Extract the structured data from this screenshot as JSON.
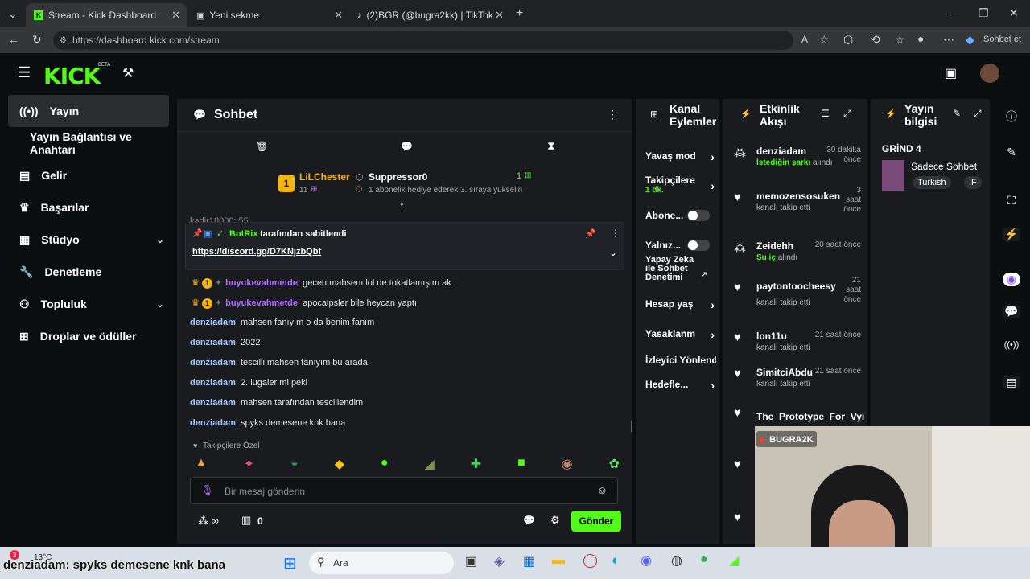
{
  "browser": {
    "tabs": [
      {
        "label": "Stream - Kick Dashboard",
        "active": true
      },
      {
        "label": "Yeni sekme",
        "active": false
      },
      {
        "label": "(2)BGR (@bugra2kk) | TikTok",
        "active": false
      }
    ],
    "url": "https://dashboard.kick.com/stream",
    "copilot_label": "Sohbet et"
  },
  "app": {
    "logo": "KICK",
    "beta": "BETA"
  },
  "sidebar": {
    "items": [
      {
        "label": "Yayın",
        "icon": "broadcast-icon"
      },
      {
        "label": "Yayın Bağlantısı ve Anahtarı",
        "icon": ""
      },
      {
        "label": "Gelir",
        "icon": "wallet-icon"
      },
      {
        "label": "Başarılar",
        "icon": "trophy-icon"
      },
      {
        "label": "Stüdyo",
        "icon": "studio-icon"
      },
      {
        "label": "Denetleme",
        "icon": "wrench-icon"
      },
      {
        "label": "Topluluk",
        "icon": "community-icon"
      },
      {
        "label": "Droplar ve ödüller",
        "icon": "gift-icon"
      }
    ]
  },
  "chat": {
    "title": "Sohbet",
    "leader": {
      "name": "LiLChester",
      "count": "11",
      "rank": "1"
    },
    "second": {
      "name": "Suppressor0",
      "subtext": "1 abonelik hediye ederek 3. sıraya yükselin",
      "count": "1"
    },
    "partial_line": "kadir18000: 55",
    "pinned": {
      "by": "BotRix",
      "suffix": "tarafından sabitlendi",
      "link": "https://discord.gg/D7KNjzbQbf"
    },
    "messages": [
      {
        "user": "buyukevahmetde",
        "text": ": gecen mahsenı lol de tokatlamışım ak",
        "purple": true
      },
      {
        "user": "buyukevahmetde",
        "text": ": apocalpsler bile heycan yaptı",
        "purple": true
      },
      {
        "user": "denziadam",
        "text": ": mahsen fanıyım o da benim fanım",
        "purple": false
      },
      {
        "user": "denziadam",
        "text": ": 2022",
        "purple": false
      },
      {
        "user": "denziadam",
        "text": ": tescilli mahsen fanıyım bu arada",
        "purple": false
      },
      {
        "user": "denziadam",
        "text": ": 2. lugaler mi peki",
        "purple": false
      },
      {
        "user": "denziadam",
        "text": ": mahsen tarafından tescillendim",
        "purple": false
      },
      {
        "user": "denziadam",
        "text": ": spyks demesene knk bana",
        "purple": false
      }
    ],
    "emote_label": "Takipçilere Özel",
    "input_placeholder": "Bir mesaj gönderin",
    "points_value": "0",
    "send_label": "Gönder"
  },
  "actions": {
    "title_line1": "Kanal",
    "title_line2": "Eylemler",
    "items": [
      {
        "label": "Yavaş mod"
      },
      {
        "label": "Takipçilere",
        "sub": "1 dk."
      },
      {
        "label": "Abone..."
      },
      {
        "label": "Yalnız..."
      },
      {
        "label": "Yapay Zeka ile Sohbet Denetimi"
      },
      {
        "label": "Hesap yaş"
      },
      {
        "label": "Yasaklanm"
      },
      {
        "label": "İzleyici Yönlendi"
      },
      {
        "label": "Hedefle..."
      }
    ]
  },
  "activity": {
    "title_line1": "Etkinlik",
    "title_line2": "Akışı",
    "events": [
      {
        "name": "denziadam",
        "time": "30 dakika önce",
        "detail_b": "İstediğin şarkı",
        "detail": "alındı"
      },
      {
        "name": "memozensosuken",
        "time": "3 saat önce",
        "detail_b": "",
        "detail": "kanalı takip etti"
      },
      {
        "name": "Zeidehh",
        "time": "20 saat önce",
        "detail_b": "Su iç",
        "detail": "alındı"
      },
      {
        "name": "paytontoocheesy",
        "time": "21 saat önce",
        "detail_b": "",
        "detail": "kanalı takip etti"
      },
      {
        "name": "lon11u",
        "time": "21 saat önce",
        "detail_b": "",
        "detail": "kanalı takip etti"
      },
      {
        "name": "SimitciAbdu",
        "time": "21 saat önce",
        "detail_b": "",
        "detail": "kanalı takip etti"
      },
      {
        "name": "The_Prototype_For_Vyi",
        "time": "",
        "detail_b": "",
        "detail": ""
      }
    ]
  },
  "info": {
    "title_line1": "Yayın",
    "title_line2": "bilgisi",
    "game": "GRİND 4",
    "category": "Sadece Sohbet",
    "tags": [
      "Turkish",
      "IF"
    ]
  },
  "webcam": {
    "name": "BUGRA2K"
  },
  "taskbar": {
    "weather": "13°C",
    "search": "Ara",
    "caption": "denziadam: spyks demesene knk bana"
  },
  "colors": {
    "accent": "#53fc18",
    "panel": "#191b1f",
    "bg": "#0b0e0f"
  }
}
